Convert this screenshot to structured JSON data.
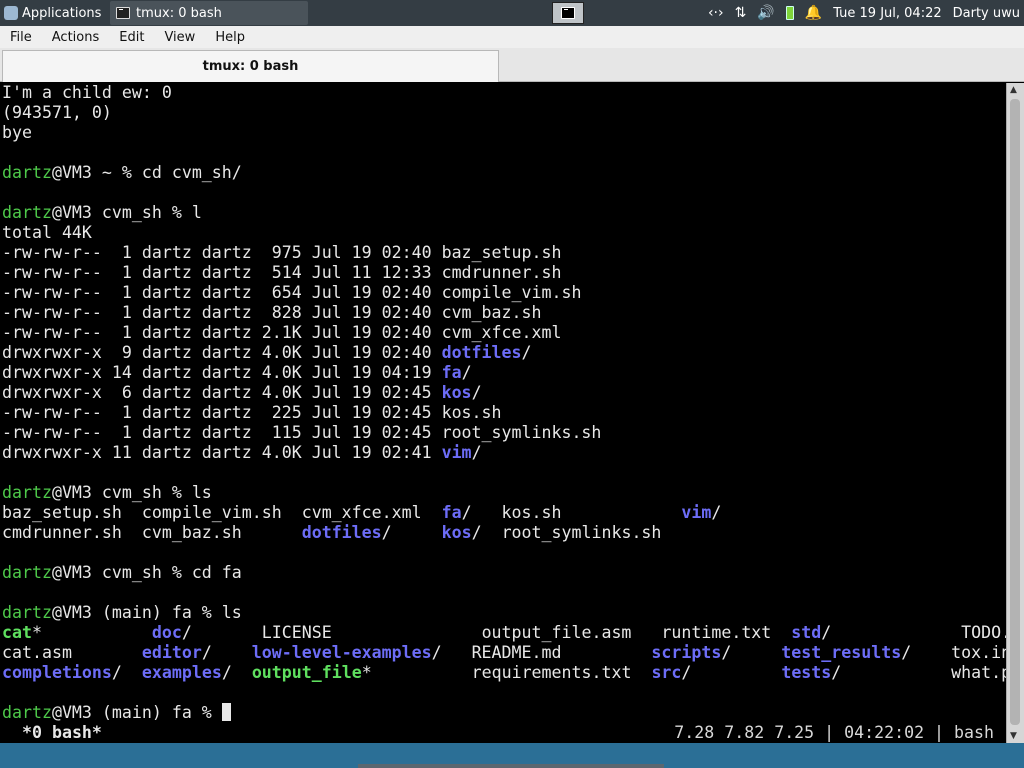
{
  "panel": {
    "applications_label": "Applications",
    "task_title": "tmux: 0 bash",
    "datetime": "Tue 19 Jul, 04:22",
    "user": "Darty uwu"
  },
  "menu": [
    "File",
    "Actions",
    "Edit",
    "View",
    "Help"
  ],
  "tab": {
    "title": "tmux: 0 bash"
  },
  "terminal": {
    "lines": [
      [
        {
          "t": "I'm a child ew: 0"
        }
      ],
      [
        {
          "t": "(943571, 0)"
        }
      ],
      [
        {
          "t": "bye"
        }
      ],
      [
        {
          "t": ""
        }
      ],
      [
        {
          "t": "dartz",
          "c": "g"
        },
        {
          "t": "@VM3 ~ % cd cvm_sh/"
        }
      ],
      [
        {
          "t": ""
        }
      ],
      [
        {
          "t": "dartz",
          "c": "g"
        },
        {
          "t": "@VM3 cvm_sh % l"
        }
      ],
      [
        {
          "t": "total 44K"
        }
      ],
      [
        {
          "t": "-rw-rw-r--  1 dartz dartz  975 Jul 19 02:40 baz_setup.sh"
        }
      ],
      [
        {
          "t": "-rw-rw-r--  1 dartz dartz  514 Jul 11 12:33 cmdrunner.sh"
        }
      ],
      [
        {
          "t": "-rw-rw-r--  1 dartz dartz  654 Jul 19 02:40 compile_vim.sh"
        }
      ],
      [
        {
          "t": "-rw-rw-r--  1 dartz dartz  828 Jul 19 02:40 cvm_baz.sh"
        }
      ],
      [
        {
          "t": "-rw-rw-r--  1 dartz dartz 2.1K Jul 19 02:40 cvm_xfce.xml"
        }
      ],
      [
        {
          "t": "drwxrwxr-x  9 dartz dartz 4.0K Jul 19 02:40 "
        },
        {
          "t": "dotfiles",
          "c": "b"
        },
        {
          "t": "/"
        }
      ],
      [
        {
          "t": "drwxrwxr-x 14 dartz dartz 4.0K Jul 19 04:19 "
        },
        {
          "t": "fa",
          "c": "b"
        },
        {
          "t": "/"
        }
      ],
      [
        {
          "t": "drwxrwxr-x  6 dartz dartz 4.0K Jul 19 02:45 "
        },
        {
          "t": "kos",
          "c": "b"
        },
        {
          "t": "/"
        }
      ],
      [
        {
          "t": "-rw-rw-r--  1 dartz dartz  225 Jul 19 02:45 kos.sh"
        }
      ],
      [
        {
          "t": "-rw-rw-r--  1 dartz dartz  115 Jul 19 02:45 root_symlinks.sh"
        }
      ],
      [
        {
          "t": "drwxrwxr-x 11 dartz dartz 4.0K Jul 19 02:41 "
        },
        {
          "t": "vim",
          "c": "b"
        },
        {
          "t": "/"
        }
      ],
      [
        {
          "t": ""
        }
      ],
      [
        {
          "t": "dartz",
          "c": "g"
        },
        {
          "t": "@VM3 cvm_sh % ls"
        }
      ],
      [
        {
          "t": "baz_setup.sh  compile_vim.sh  cvm_xfce.xml  "
        },
        {
          "t": "fa",
          "c": "b"
        },
        {
          "t": "/   kos.sh            "
        },
        {
          "t": "vim",
          "c": "b"
        },
        {
          "t": "/"
        }
      ],
      [
        {
          "t": "cmdrunner.sh  cvm_baz.sh      "
        },
        {
          "t": "dotfiles",
          "c": "b"
        },
        {
          "t": "/     "
        },
        {
          "t": "kos",
          "c": "b"
        },
        {
          "t": "/  root_symlinks.sh"
        }
      ],
      [
        {
          "t": ""
        }
      ],
      [
        {
          "t": "dartz",
          "c": "g"
        },
        {
          "t": "@VM3 cvm_sh % cd fa"
        }
      ],
      [
        {
          "t": ""
        }
      ],
      [
        {
          "t": "dartz",
          "c": "g"
        },
        {
          "t": "@VM3 (main) fa % ls"
        }
      ],
      [
        {
          "t": "cat",
          "c": "gb"
        },
        {
          "t": "*           "
        },
        {
          "t": "doc",
          "c": "b"
        },
        {
          "t": "/       LICENSE               output_file.asm   runtime.txt  "
        },
        {
          "t": "std",
          "c": "b"
        },
        {
          "t": "/             TODO.md"
        }
      ],
      [
        {
          "t": "cat.asm       "
        },
        {
          "t": "editor",
          "c": "b"
        },
        {
          "t": "/    "
        },
        {
          "t": "low-level-examples",
          "c": "b"
        },
        {
          "t": "/   README.md         "
        },
        {
          "t": "scripts",
          "c": "b"
        },
        {
          "t": "/     "
        },
        {
          "t": "test_results",
          "c": "b"
        },
        {
          "t": "/    tox.ini"
        }
      ],
      [
        {
          "t": "completions",
          "c": "b"
        },
        {
          "t": "/  "
        },
        {
          "t": "examples",
          "c": "b"
        },
        {
          "t": "/  "
        },
        {
          "t": "output_file",
          "c": "gb"
        },
        {
          "t": "*          requirements.txt  "
        },
        {
          "t": "src",
          "c": "b"
        },
        {
          "t": "/         "
        },
        {
          "t": "tests",
          "c": "b"
        },
        {
          "t": "/           what.py"
        }
      ],
      [
        {
          "t": ""
        }
      ],
      [
        {
          "t": "dartz",
          "c": "g"
        },
        {
          "t": "@VM3 (main) fa % "
        },
        {
          "t": "",
          "c": "cursor"
        }
      ]
    ]
  },
  "status": {
    "left": " *0 bash*",
    "right": "7.28 7.82 7.25 | 04:22:02 | bash"
  }
}
